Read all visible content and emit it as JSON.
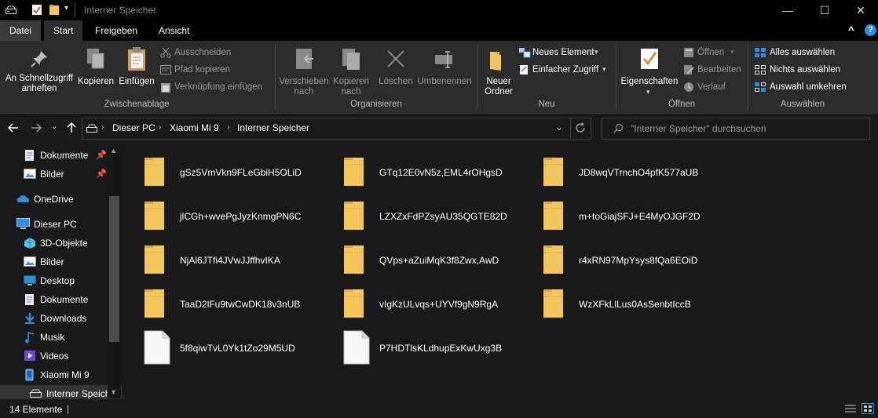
{
  "window": {
    "title": "Interner Speicher",
    "minimize_glyph": "—",
    "maximize_glyph": "☐",
    "close_glyph": "✕"
  },
  "ribbon_tabs": [
    "Datei",
    "Start",
    "Freigeben",
    "Ansicht"
  ],
  "ribbon_help_glyph": "?",
  "ribbon_collapse_glyph": "^",
  "ribbon": {
    "clipboard": {
      "pin_label_1": "An Schnellzugriff",
      "pin_label_2": "anheften",
      "copy": "Kopieren",
      "paste": "Einfügen",
      "cut": "Ausschneiden",
      "copy_path": "Pfad kopieren",
      "paste_shortcut": "Verknüpfung einfügen",
      "group": "Zwischenablage"
    },
    "organize": {
      "move_1": "Verschieben",
      "move_2": "nach",
      "copy_1": "Kopieren",
      "copy_2": "nach",
      "delete": "Löschen",
      "rename": "Umbenennen",
      "group": "Organisieren"
    },
    "new": {
      "new_folder_1": "Neuer",
      "new_folder_2": "Ordner",
      "new_item": "Neues Element",
      "easy_access": "Einfacher Zugriff",
      "group": "Neu"
    },
    "open": {
      "properties": "Eigenschaften",
      "open": "Öffnen",
      "edit": "Bearbeiten",
      "history": "Verlauf",
      "group": "Öffnen"
    },
    "select": {
      "select_all": "Alles auswählen",
      "select_none": "Nichts auswählen",
      "invert": "Auswahl umkehren",
      "group": "Auswählen"
    }
  },
  "address": {
    "crumbs": [
      "Dieser PC",
      "Xiaomi Mi 9",
      "Interner Speicher"
    ],
    "search_placeholder": "\"Interner Speicher\" durchsuchen"
  },
  "sidebar": {
    "items": [
      {
        "label": "Dokumente",
        "icon": "documents-icon"
      },
      {
        "label": "Bilder",
        "icon": "pictures-icon"
      },
      {
        "label": "OneDrive",
        "icon": "onedrive-icon"
      },
      {
        "label": "Dieser PC",
        "icon": "this-pc-icon"
      },
      {
        "label": "3D-Objekte",
        "icon": "3d-objects-icon"
      },
      {
        "label": "Bilder",
        "icon": "pictures-icon"
      },
      {
        "label": "Desktop",
        "icon": "desktop-icon"
      },
      {
        "label": "Dokumente",
        "icon": "documents-icon"
      },
      {
        "label": "Downloads",
        "icon": "downloads-icon"
      },
      {
        "label": "Musik",
        "icon": "music-icon"
      },
      {
        "label": "Videos",
        "icon": "videos-icon"
      },
      {
        "label": "Xiaomi Mi 9",
        "icon": "phone-icon"
      },
      {
        "label": "Interner Speich",
        "icon": "drive-icon"
      }
    ]
  },
  "files": [
    {
      "name": "gSz5VmVkn9FLeGbiH5OLiD",
      "type": "folder"
    },
    {
      "name": "GTq12E0vN5z,EML4rOHgsD",
      "type": "folder"
    },
    {
      "name": "JD8wqVTrnchO4pfK577aUB",
      "type": "folder"
    },
    {
      "name": "jlCGh+wvePgJyzKnmgPN6C",
      "type": "folder"
    },
    {
      "name": "LZXZxFdPZsyAU35QGTE82D",
      "type": "folder"
    },
    {
      "name": "m+toGiajSFJ+E4MyOJGF2D",
      "type": "folder"
    },
    {
      "name": "NjAl6JTfi4JVwJJffhvIKA",
      "type": "folder"
    },
    {
      "name": "QVps+aZuiMqK3f8Zwx,AwD",
      "type": "folder"
    },
    {
      "name": "r4xRN97MpYsys8fQa6EOiD",
      "type": "folder"
    },
    {
      "name": "TaaD2lFu9twCwDK18v3nUB",
      "type": "folder"
    },
    {
      "name": "vIgKzULvqs+UYVf9gN9RgA",
      "type": "folder"
    },
    {
      "name": "WzXFkLlLus0AsSenbtIccB",
      "type": "folder"
    },
    {
      "name": "5f8qiwTvL0Yk1tZo29M5UD",
      "type": "file"
    },
    {
      "name": "P7HDTlsKLdhupExKwUxg3B",
      "type": "file"
    }
  ],
  "status": {
    "count": "14 Elemente",
    "cursor": "|"
  },
  "colors": {
    "folder": "#f3c65c",
    "folder_dark": "#dba93d",
    "accent": "#2d8fe0",
    "background": "#191919",
    "ribbon": "#2b2b2b"
  }
}
